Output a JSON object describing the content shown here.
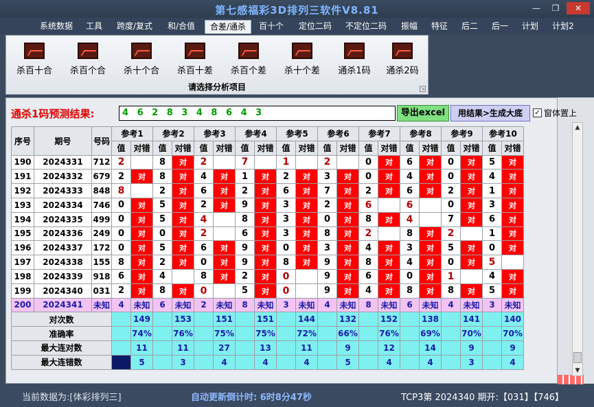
{
  "title": "第七感福彩3D排列三软件V8.81",
  "window": {
    "minimize": "—",
    "restore": "❐",
    "close": "✕"
  },
  "menu": [
    "系统数据",
    "工具",
    "跨度/复式",
    "和/合值",
    "合差/通杀",
    "百十个",
    "定位二码",
    "不定位二码",
    "振幅",
    "特征",
    "后二",
    "后一",
    "计划",
    "计划2"
  ],
  "active_menu": "合差/通杀",
  "ribbon": {
    "buttons": [
      "杀百十合",
      "杀百个合",
      "杀十个合",
      "杀百十差",
      "杀百个差",
      "杀十个差",
      "通杀1码",
      "通杀2码"
    ],
    "caption": "请选择分析项目"
  },
  "prediction": {
    "label": "通杀1码预测结果:",
    "value": "4 6 2 8 3 4 8 6 4 3"
  },
  "buttons": {
    "excel": "导出excel",
    "generate": "用结果>生成大底"
  },
  "checkbox": {
    "label": "窗体置上",
    "checked": true,
    "mark": "✓"
  },
  "table": {
    "headers": {
      "seq": "序号",
      "issue": "期号",
      "number": "号码",
      "value": "值",
      "correct": "对错",
      "ok": "对"
    },
    "refs": [
      "参考1",
      "参考2",
      "参考3",
      "参考4",
      "参考5",
      "参考6",
      "参考7",
      "参考8",
      "参考9",
      "参考10"
    ],
    "rows": [
      {
        "seq": "190",
        "issue": "2024331",
        "num": "712",
        "vals": [
          "2",
          "8",
          "2",
          "7",
          "1",
          "2",
          "0",
          "6",
          "0",
          "5"
        ],
        "hits": [
          0,
          1,
          0,
          0,
          0,
          0,
          1,
          1,
          1,
          1
        ],
        "hl": [
          1,
          0,
          1,
          1,
          1,
          1,
          0,
          0,
          0,
          0
        ]
      },
      {
        "seq": "191",
        "issue": "2024332",
        "num": "679",
        "vals": [
          "2",
          "8",
          "4",
          "1",
          "2",
          "3",
          "0",
          "4",
          "0",
          "4"
        ],
        "hits": [
          1,
          1,
          1,
          1,
          1,
          1,
          1,
          1,
          1,
          1
        ],
        "hl": [
          0,
          0,
          0,
          0,
          0,
          0,
          0,
          0,
          0,
          0
        ]
      },
      {
        "seq": "192",
        "issue": "2024333",
        "num": "848",
        "vals": [
          "8",
          "2",
          "6",
          "2",
          "6",
          "7",
          "2",
          "6",
          "2",
          "1"
        ],
        "hits": [
          0,
          1,
          1,
          1,
          1,
          1,
          1,
          1,
          1,
          1
        ],
        "hl": [
          1,
          0,
          0,
          0,
          0,
          0,
          0,
          0,
          0,
          0
        ]
      },
      {
        "seq": "193",
        "issue": "2024334",
        "num": "746",
        "vals": [
          "0",
          "5",
          "2",
          "9",
          "3",
          "2",
          "6",
          "6",
          "0",
          "3"
        ],
        "hits": [
          1,
          1,
          1,
          1,
          1,
          1,
          0,
          0,
          1,
          1
        ],
        "hl": [
          0,
          0,
          0,
          0,
          0,
          0,
          1,
          1,
          0,
          0
        ]
      },
      {
        "seq": "194",
        "issue": "2024335",
        "num": "499",
        "vals": [
          "0",
          "5",
          "4",
          "8",
          "3",
          "0",
          "8",
          "4",
          "7",
          "6"
        ],
        "hits": [
          1,
          1,
          0,
          1,
          1,
          1,
          1,
          0,
          1,
          1
        ],
        "hl": [
          0,
          0,
          1,
          0,
          0,
          0,
          0,
          1,
          0,
          0
        ]
      },
      {
        "seq": "195",
        "issue": "2024336",
        "num": "249",
        "vals": [
          "0",
          "0",
          "2",
          "6",
          "3",
          "8",
          "2",
          "8",
          "2",
          "1"
        ],
        "hits": [
          1,
          1,
          0,
          1,
          1,
          1,
          0,
          1,
          0,
          1
        ],
        "hl": [
          0,
          0,
          1,
          0,
          0,
          0,
          1,
          0,
          1,
          0
        ]
      },
      {
        "seq": "196",
        "issue": "2024337",
        "num": "172",
        "vals": [
          "0",
          "5",
          "6",
          "9",
          "0",
          "3",
          "4",
          "3",
          "5",
          "0"
        ],
        "hits": [
          1,
          1,
          1,
          1,
          1,
          1,
          1,
          1,
          1,
          1
        ],
        "hl": [
          0,
          0,
          0,
          0,
          0,
          0,
          0,
          0,
          0,
          0
        ]
      },
      {
        "seq": "197",
        "issue": "2024338",
        "num": "155",
        "vals": [
          "8",
          "2",
          "0",
          "9",
          "8",
          "9",
          "8",
          "4",
          "0",
          "5"
        ],
        "hits": [
          1,
          1,
          1,
          1,
          1,
          1,
          1,
          1,
          1,
          0
        ],
        "hl": [
          0,
          0,
          0,
          0,
          0,
          0,
          0,
          0,
          0,
          1
        ]
      },
      {
        "seq": "198",
        "issue": "2024339",
        "num": "918",
        "vals": [
          "6",
          "4",
          "8",
          "2",
          "0",
          "9",
          "6",
          "0",
          "1",
          "4"
        ],
        "hits": [
          1,
          0,
          1,
          1,
          0,
          1,
          1,
          1,
          0,
          1
        ],
        "hl": [
          0,
          0,
          0,
          0,
          1,
          0,
          0,
          0,
          1,
          0
        ]
      },
      {
        "seq": "199",
        "issue": "2024340",
        "num": "031",
        "vals": [
          "2",
          "8",
          "0",
          "5",
          "0",
          "9",
          "4",
          "8",
          "8",
          "5"
        ],
        "hits": [
          1,
          1,
          0,
          1,
          0,
          1,
          1,
          1,
          1,
          1
        ],
        "hl": [
          0,
          0,
          1,
          0,
          1,
          0,
          0,
          0,
          0,
          0
        ]
      }
    ],
    "unknown_row": {
      "seq": "200",
      "issue": "2024341",
      "num": "未知",
      "vals": [
        "4",
        "6",
        "2",
        "8",
        "3",
        "4",
        "8",
        "6",
        "4",
        "3"
      ],
      "mark": "未知"
    },
    "stats": [
      {
        "label": "对次数",
        "vals": [
          "149",
          "153",
          "151",
          "151",
          "144",
          "132",
          "152",
          "138",
          "141",
          "140"
        ]
      },
      {
        "label": "准确率",
        "vals": [
          "74%",
          "76%",
          "75%",
          "75%",
          "72%",
          "66%",
          "76%",
          "69%",
          "70%",
          "70%"
        ]
      },
      {
        "label": "最大连对数",
        "vals": [
          "11",
          "11",
          "27",
          "13",
          "11",
          "9",
          "12",
          "14",
          "9",
          "9"
        ]
      },
      {
        "label": "最大连错数",
        "vals": [
          "5",
          "3",
          "4",
          "4",
          "4",
          "5",
          "4",
          "4",
          "3",
          "4"
        ]
      }
    ]
  },
  "status": {
    "current_data": "当前数据为:[体彩排列三]",
    "countdown": "自动更新倒计时: 6时8分47秒",
    "draw": "TCP3第 2024340 期开:【031】【746】"
  },
  "colors": {
    "hit": "#ff0000",
    "unknown_row": "#f3c4f3",
    "stats": "#7ff0f0",
    "accent_title": "#7fb6ff"
  }
}
